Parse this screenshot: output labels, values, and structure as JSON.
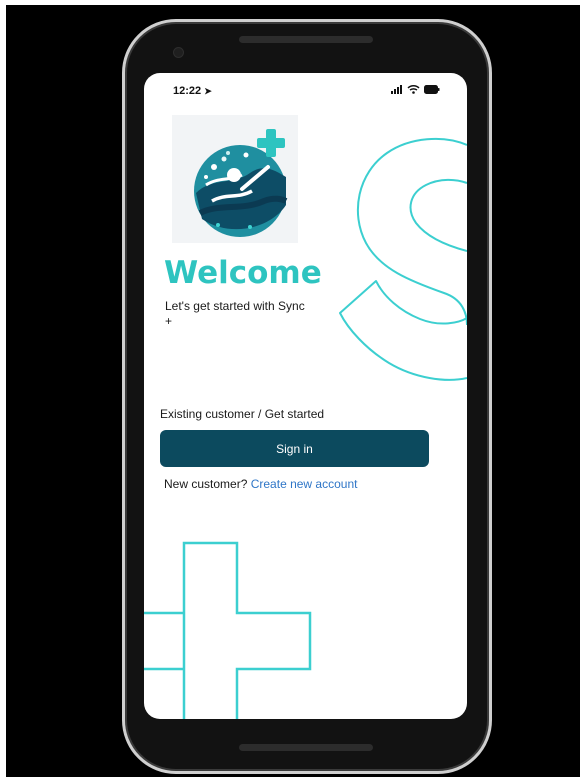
{
  "status_bar": {
    "time": "12:22",
    "icons": [
      "location-arrow-icon",
      "signal-icon",
      "wifi-icon",
      "battery-icon"
    ]
  },
  "logo": {
    "name": "sync-plus-logo",
    "icon": "swimmer-with-plus-icon"
  },
  "welcome": {
    "title": "Welcome",
    "subtitle": "Let's get started with Sync +"
  },
  "auth": {
    "existing_label": "Existing customer / Get started",
    "signin_label": "Sign in",
    "new_customer_text": "New customer?",
    "create_account_link": "Create new account"
  },
  "colors": {
    "accent": "#2ec4c0",
    "button": "#0c4a5e",
    "link": "#2f76c7",
    "background": "#000000"
  }
}
